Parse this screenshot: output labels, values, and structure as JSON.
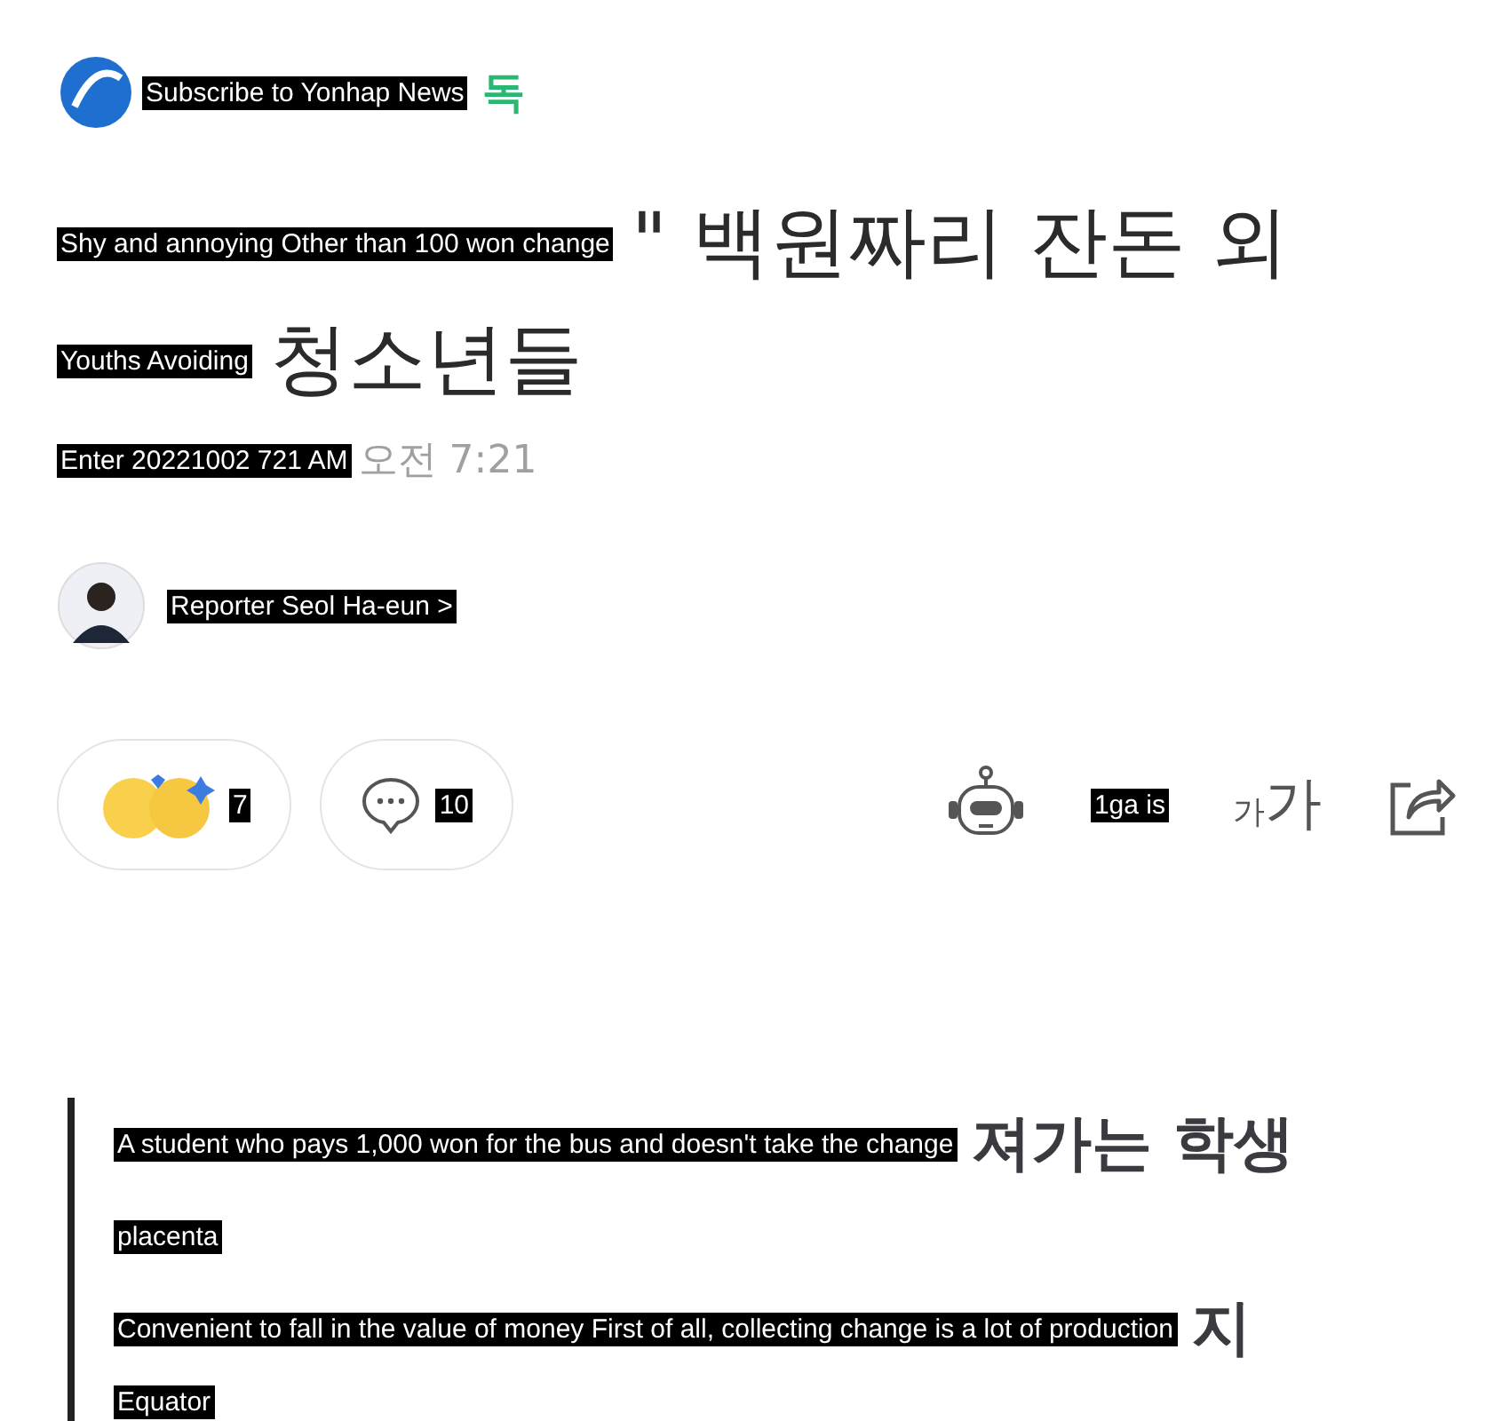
{
  "header": {
    "subscribe_overlay": "Subscribe to Yonhap News",
    "subscribe_visible": "독"
  },
  "title": {
    "lines": [
      {
        "overlay": "Shy and annoying Other than 100 won change",
        "visible": "\" 백원짜리 잔돈 외"
      },
      {
        "overlay": "Youths Avoiding",
        "visible": "청소년들"
      }
    ]
  },
  "date": {
    "overlay": "Enter 20221002 721 AM",
    "visible": "오전 7:21"
  },
  "reporter": {
    "overlay": "Reporter Seol Ha-eun >"
  },
  "reactions": {
    "count": "7"
  },
  "comments": {
    "count": "10"
  },
  "tools": {
    "listen_overlay": "1ga is",
    "font_small": "가",
    "font_large": "가"
  },
  "subheading": {
    "lines": [
      {
        "overlay": "A student who pays 1,000 won for the bus and doesn't take the change",
        "visible": "져가는 학생"
      },
      {
        "overlay": "placenta"
      },
      {
        "overlay": "Convenient to fall in the value of money First of all, collecting change is a lot of production",
        "visible": "지"
      },
      {
        "overlay": "Equator"
      }
    ]
  }
}
